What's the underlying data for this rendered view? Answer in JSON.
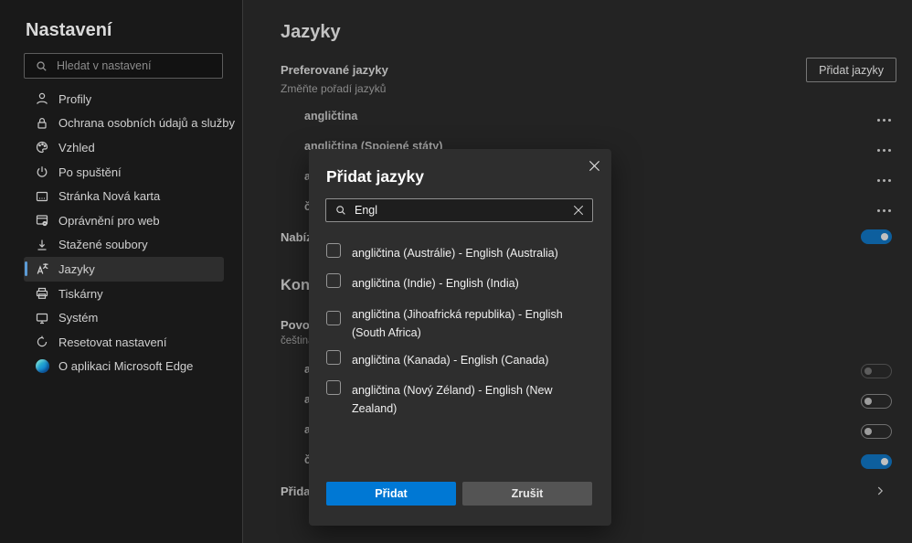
{
  "colors": {
    "accent": "#0078d4",
    "selected_indicator": "#5b9bd5",
    "toggle_on_dimmed": "#0d5f9e"
  },
  "sidebar": {
    "title": "Nastavení",
    "search_placeholder": "Hledat v nastavení",
    "items": [
      {
        "label": "Profily",
        "icon": "person-icon"
      },
      {
        "label": "Ochrana osobních údajů a služby",
        "icon": "lock-icon"
      },
      {
        "label": "Vzhled",
        "icon": "palette-icon"
      },
      {
        "label": "Po spuštění",
        "icon": "power-icon"
      },
      {
        "label": "Stránka Nová karta",
        "icon": "new-tab-page-icon"
      },
      {
        "label": "Oprávnění pro web",
        "icon": "site-permissions-icon"
      },
      {
        "label": "Stažené soubory",
        "icon": "download-icon"
      },
      {
        "label": "Jazyky",
        "icon": "translate-icon",
        "selected": true
      },
      {
        "label": "Tiskárny",
        "icon": "printer-icon"
      },
      {
        "label": "Systém",
        "icon": "monitor-icon"
      },
      {
        "label": "Resetovat nastavení",
        "icon": "reset-icon"
      },
      {
        "label": "O aplikaci Microsoft Edge",
        "icon": "edge-logo-icon"
      }
    ]
  },
  "main": {
    "page_title": "Jazyky",
    "preferred": {
      "heading": "Preferované jazyky",
      "subheading": "Změňte pořadí jazyků",
      "add_button_label": "Přidat jazyky",
      "languages": [
        {
          "label": "angličtina"
        },
        {
          "label": "angličtina (Spojené státy)"
        },
        {
          "label": "an"
        },
        {
          "label": "če"
        }
      ],
      "offer_translate_label": "Nabíz"
    },
    "spellcheck": {
      "heading": "Kon",
      "enable_label": "Povol",
      "enable_sublabel": "čeština",
      "languages": [
        {
          "label": "an",
          "toggle": "off-disabled"
        },
        {
          "label": "an",
          "toggle": "off"
        },
        {
          "label": "an",
          "toggle": "off"
        },
        {
          "label": "če",
          "toggle": "on"
        }
      ],
      "add_words_label": "Přidat"
    }
  },
  "dialog": {
    "title": "Přidat jazyky",
    "search_value": "Engl",
    "options": [
      {
        "label": "angličtina (Austrálie) - English (Australia)"
      },
      {
        "label": "angličtina (Indie) - English (India)"
      },
      {
        "label": "angličtina (Jihoafrická republika) - English (South Africa)"
      },
      {
        "label": "angličtina (Kanada) - English (Canada)"
      },
      {
        "label": "angličtina (Nový Zéland) - English (New Zealand)"
      }
    ],
    "add_button_label": "Přidat",
    "cancel_button_label": "Zrušit"
  }
}
